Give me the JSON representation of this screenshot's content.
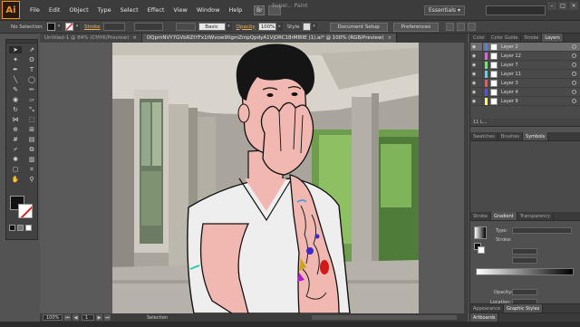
{
  "app": {
    "logo": "Ai",
    "title": "Super... Paint"
  },
  "menu": [
    "File",
    "Edit",
    "Object",
    "Type",
    "Select",
    "Effect",
    "View",
    "Window",
    "Help"
  ],
  "workspace": "Essentials",
  "control_bar": {
    "selection_label": "No Selection",
    "stroke_label": "Stroke",
    "brush_label": "Basic",
    "opacity_label": "Opacity",
    "opacity_value": "100%",
    "style_label": "Style",
    "document_setup": "Document Setup",
    "preferences": "Preferences"
  },
  "doc_tabs": [
    {
      "label": "Untitled-1 @ 84% (CMYK/Preview)",
      "close": "×",
      "active": false
    },
    {
      "label": "DQpmNVY7GVbRZtYFx1tWvow90gmZmpQpdyA1VjDRC18rM8IIE (1).ai* @ 100% (RGB/Preview)",
      "close": "×",
      "active": true
    }
  ],
  "status_bar": {
    "zoom": "100%",
    "page": "1",
    "tool": "Selection"
  },
  "panels": {
    "top_tabs": [
      "Color",
      "Color Guide",
      "Stroke",
      "Layers"
    ],
    "layers": [
      {
        "name": "Layer 2",
        "color": "#4f7fff",
        "selected": true
      },
      {
        "name": "Layer 12",
        "color": "#ff4fff",
        "selected": false
      },
      {
        "name": "Layer 7",
        "color": "#4fff4f",
        "selected": false
      },
      {
        "name": "Layer 11",
        "color": "#4fd7ff",
        "selected": false
      },
      {
        "name": "Layer 3",
        "color": "#ff4f4f",
        "selected": false
      },
      {
        "name": "Layer 4",
        "color": "#4f4fff",
        "selected": false
      },
      {
        "name": "Layer 9",
        "color": "#ffff4f",
        "selected": false
      }
    ],
    "layers_footer": "11 L...",
    "mid_tabs": [
      "Swatches",
      "Brushes",
      "Symbols"
    ],
    "grad_tabs": [
      "Stroke",
      "Gradient",
      "Transparency"
    ],
    "gradient": {
      "type_label": "Type:",
      "stroke_label": "Stroke:",
      "opacity_label": "Opacity:",
      "location_label": "Location:"
    },
    "bottom_tabs_1": [
      "Appearance",
      "Graphic Styles"
    ],
    "bottom_tabs_2": [
      "Artboards"
    ]
  },
  "colors": {
    "brand_orange": "#f7941e",
    "skin": "#f0b8b0",
    "hair": "#151515",
    "shirt": "#ececec"
  }
}
